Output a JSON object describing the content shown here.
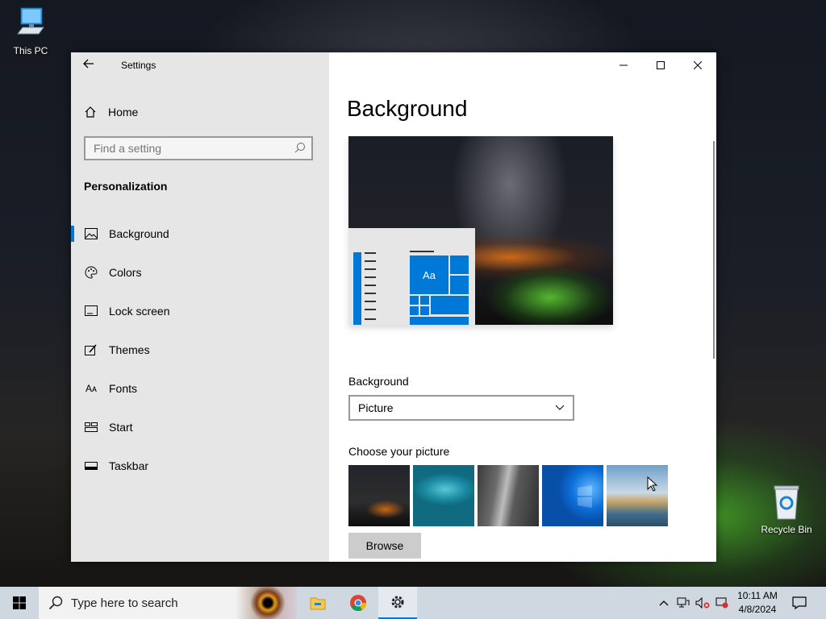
{
  "desktop": {
    "icons": [
      {
        "label": "This PC"
      },
      {
        "label": "Recycle Bin"
      }
    ]
  },
  "window": {
    "title": "Settings",
    "controls": {
      "minimize": "minimize",
      "maximize": "maximize",
      "close": "close"
    }
  },
  "sidebar": {
    "home_label": "Home",
    "search_placeholder": "Find a setting",
    "section_title": "Personalization",
    "items": [
      {
        "label": "Background",
        "icon": "picture-icon",
        "active": true
      },
      {
        "label": "Colors",
        "icon": "palette-icon",
        "active": false
      },
      {
        "label": "Lock screen",
        "icon": "lock-screen-icon",
        "active": false
      },
      {
        "label": "Themes",
        "icon": "themes-icon",
        "active": false
      },
      {
        "label": "Fonts",
        "icon": "fonts-icon",
        "active": false
      },
      {
        "label": "Start",
        "icon": "start-icon",
        "active": false
      },
      {
        "label": "Taskbar",
        "icon": "taskbar-icon",
        "active": false
      }
    ]
  },
  "main": {
    "page_title": "Background",
    "preview": {
      "tile_label": "Aa"
    },
    "background_label": "Background",
    "background_value": "Picture",
    "choose_picture_label": "Choose your picture",
    "browse_label": "Browse"
  },
  "taskbar": {
    "search_placeholder": "Type here to search",
    "apps": [
      "file-explorer-icon",
      "chrome-icon",
      "settings-icon"
    ],
    "clock": {
      "time": "10:11 AM",
      "date": "4/8/2024"
    }
  },
  "colors": {
    "accent": "#0078d7",
    "sidebar_bg": "#e6e6e6",
    "taskbar_bg": "#cfd7e1"
  }
}
